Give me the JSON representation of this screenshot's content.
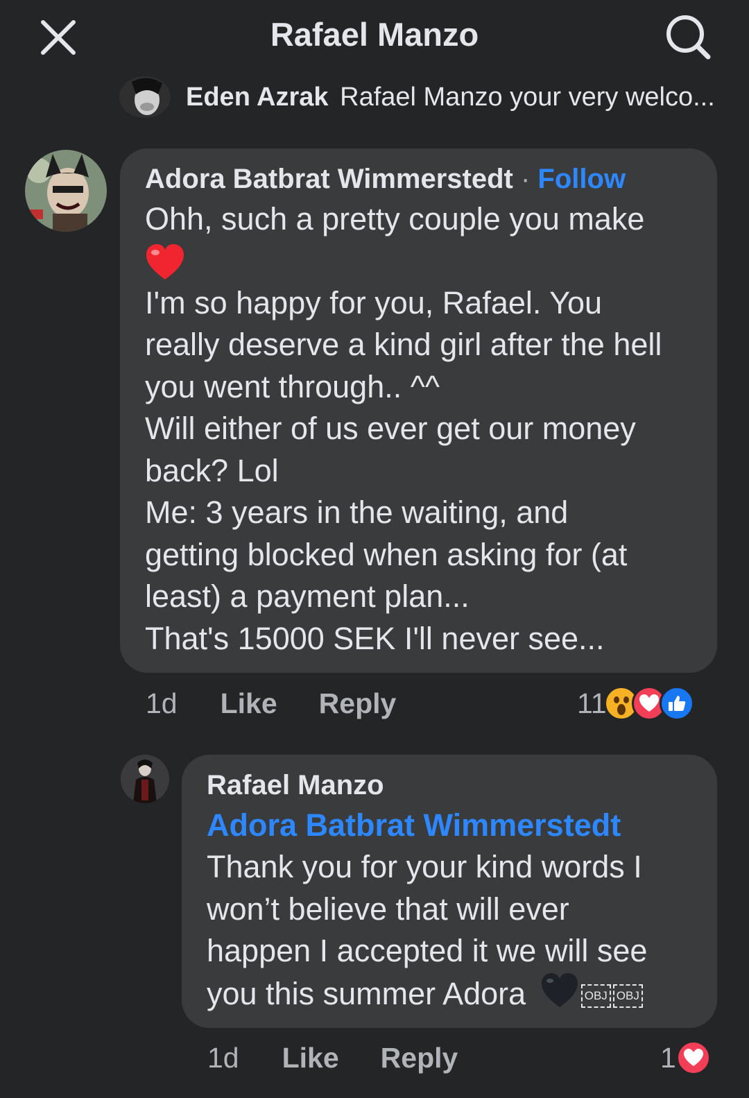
{
  "header": {
    "title": "Rafael Manzo",
    "close_icon": "close-icon",
    "search_icon": "search-icon"
  },
  "preview": {
    "name": "Eden Azrak",
    "message": "Rafael Manzo your very welco..."
  },
  "comments": [
    {
      "author": "Adora Batbrat Wimmerstedt",
      "separator": "·",
      "follow_label": "Follow",
      "lines": [
        "Ohh, such a pretty couple you make",
        "I'm so happy for you, Rafael. You",
        "really deserve a kind girl after the hell",
        "you went through.. ^^",
        "Will either of us ever get our money",
        "back? Lol",
        "Me: 3 years in the waiting, and",
        "getting blocked when asking for (at",
        "least) a payment plan...",
        "That's 15000 SEK I'll never see..."
      ],
      "emoji_line": "❤️",
      "time": "1d",
      "like_label": "Like",
      "reply_label": "Reply",
      "reaction_count": "11",
      "reactions": [
        "wow-icon",
        "love-icon",
        "like-icon"
      ]
    },
    {
      "author": "Rafael Manzo",
      "mention": "Adora Batbrat Wimmerstedt",
      "lines": [
        "Thank you for your kind words I",
        "won’t believe that will ever",
        "happen I accepted it we will see",
        "you this summer Adora"
      ],
      "trailing_emoji": "🖤",
      "obj_marks": [
        "OBJ",
        "OBJ"
      ],
      "time": "1d",
      "like_label": "Like",
      "reply_label": "Reply",
      "reaction_count": "1",
      "reactions": [
        "love-icon"
      ]
    }
  ],
  "colors": {
    "background": "#242526",
    "bubble": "#3a3b3c",
    "link": "#2d88ff",
    "text": "#e4e6eb",
    "muted": "#b0b3b8",
    "love": "#f33e58",
    "like": "#1877f2",
    "wow": "#f7b125"
  }
}
